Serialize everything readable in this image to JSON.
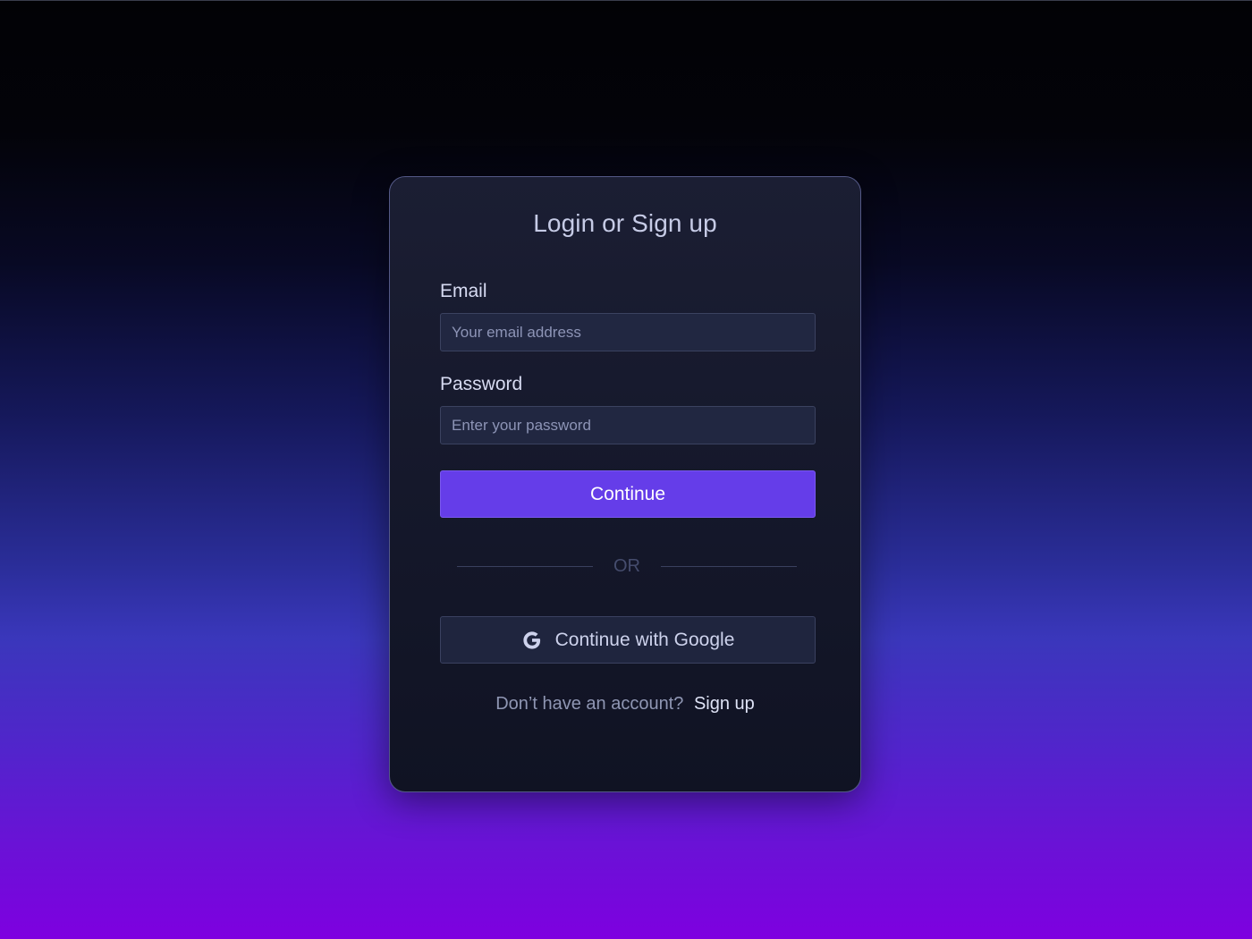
{
  "colors": {
    "accent": "#653de9",
    "card_background": "#171a2d",
    "input_background": "#212741"
  },
  "card": {
    "title": "Login or Sign up",
    "email": {
      "label": "Email",
      "placeholder": "Your email address",
      "value": ""
    },
    "password": {
      "label": "Password",
      "placeholder": "Enter your password",
      "value": ""
    },
    "continue_label": "Continue",
    "divider_text": "OR",
    "google_button": {
      "icon": "google-icon",
      "label": "Continue with Google"
    },
    "signup": {
      "prompt": "Don’t have an account?",
      "link_label": "Sign up"
    }
  }
}
